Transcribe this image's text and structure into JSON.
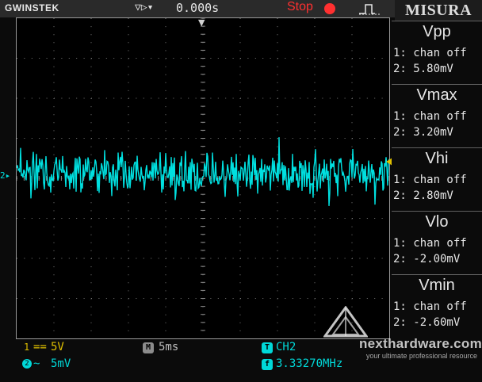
{
  "topbar": {
    "brand": "GWINSTEK",
    "trigger_icons": "▽▷▾",
    "time_offset": "0.000s",
    "run_status": "Stop",
    "trigger_edge_icon": "rising-edge-icon",
    "menu_title": "MISURA"
  },
  "screen": {
    "ch2_marker": "2▸",
    "trigger_marker": "▼",
    "trace_color": "#00e0e0",
    "trace_level_div": 0.1,
    "trace_noise_mv": 3
  },
  "measurements": [
    {
      "title": "Vpp",
      "ch1": "1: chan off",
      "ch2": "2: 5.80mV"
    },
    {
      "title": "Vmax",
      "ch1": "1: chan off",
      "ch2": "2: 3.20mV"
    },
    {
      "title": "Vhi",
      "ch1": "1: chan off",
      "ch2": "2: 2.80mV"
    },
    {
      "title": "Vlo",
      "ch1": "1: chan off",
      "ch2": "2: -2.00mV"
    },
    {
      "title": "Vmin",
      "ch1": "1: chan off",
      "ch2": "2: -2.60mV"
    }
  ],
  "bottombar": {
    "ch1": {
      "number": "1",
      "coupling": "==",
      "scale": "5V",
      "color": "#e0c000"
    },
    "ch2": {
      "number": "2",
      "coupling": "~",
      "scale": "5mV",
      "color": "#00d8d8"
    },
    "timebase": {
      "icon": "M",
      "value": "5ms"
    },
    "trigger": {
      "icon": "T",
      "source": "CH2"
    },
    "frequency": {
      "icon": "f",
      "value": "3.33270MHz"
    }
  },
  "watermark": {
    "text": "nexthardware.com",
    "subtitle": "your ultimate professional resource"
  }
}
